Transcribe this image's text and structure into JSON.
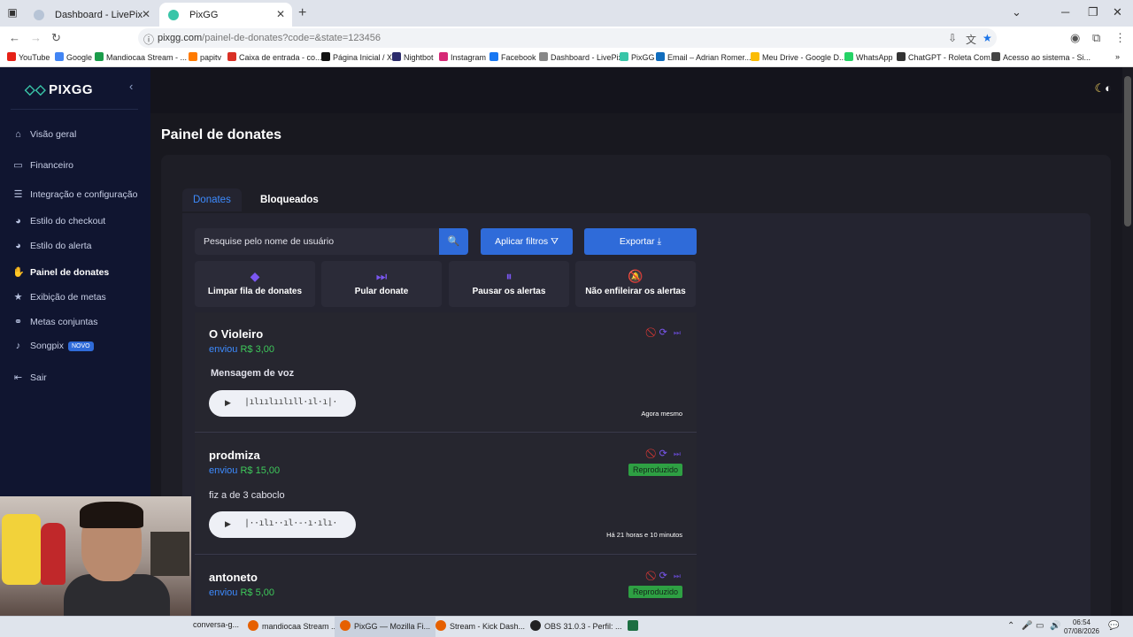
{
  "browser": {
    "tabs": [
      {
        "label": "Dashboard - LivePix",
        "active": false
      },
      {
        "label": "PixGG",
        "active": true
      }
    ],
    "url_host": "pixgg.com",
    "url_path": "/painel-de-donates?code=&state=123456",
    "bookmarks": [
      {
        "label": "YouTube",
        "color": "#e62117"
      },
      {
        "label": "Google",
        "color": "#4285f4"
      },
      {
        "label": "Mandiocaa Stream - ...",
        "color": "#1a9c4a"
      },
      {
        "label": "papitv",
        "color": "#ff7a00"
      },
      {
        "label": "Caixa de entrada - co...",
        "color": "#d93025"
      },
      {
        "label": "Página Inicial / X",
        "color": "#111111"
      },
      {
        "label": "Nightbot",
        "color": "#2b2b6b"
      },
      {
        "label": "Instagram",
        "color": "#d62976"
      },
      {
        "label": "Facebook",
        "color": "#1877f2"
      },
      {
        "label": "Dashboard - LivePix",
        "color": "#888888"
      },
      {
        "label": "PixGG",
        "color": "#39c5a8"
      },
      {
        "label": "Email – Adrian Romer...",
        "color": "#0f6cbd"
      },
      {
        "label": "Meu Drive - Google D...",
        "color": "#fbbc04"
      },
      {
        "label": "WhatsApp",
        "color": "#25d366"
      },
      {
        "label": "ChatGPT - Roleta Com...",
        "color": "#333333"
      },
      {
        "label": "Acesso ao sistema - Si...",
        "color": "#444444"
      }
    ]
  },
  "sidebar": {
    "logo": "PIXGG",
    "items": [
      {
        "label": "Visão geral",
        "icon": "home-icon",
        "glyph": "⌂"
      },
      {
        "label": "Financeiro",
        "icon": "wallet-icon",
        "glyph": "▭"
      },
      {
        "label": "Integração e configuração",
        "icon": "document-icon",
        "glyph": "☰"
      },
      {
        "label": "Estilo do checkout",
        "icon": "palette-icon",
        "glyph": "◕"
      },
      {
        "label": "Estilo do alerta",
        "icon": "palette-icon",
        "glyph": "◕"
      },
      {
        "label": "Painel de donates",
        "icon": "hand-coins-icon",
        "glyph": "✋"
      },
      {
        "label": "Exibição de metas",
        "icon": "star-icon",
        "glyph": "★"
      },
      {
        "label": "Metas conjuntas",
        "icon": "link-icon",
        "glyph": "⚭"
      },
      {
        "label": "Songpix",
        "icon": "music-icon",
        "glyph": "♪",
        "badge": "NOVO"
      },
      {
        "label": "Sair",
        "icon": "logout-icon",
        "glyph": "⇤"
      }
    ],
    "active_index": 5
  },
  "page": {
    "title": "Painel de donates",
    "tabs": [
      "Donates",
      "Bloqueados"
    ],
    "search_placeholder": "Pesquise pelo nome de usuário",
    "filter_label": "Aplicar filtros",
    "export_label": "Exportar",
    "actions": [
      {
        "label": "Limpar fila de donates",
        "icon": "eraser-icon",
        "glyph": "◆"
      },
      {
        "label": "Pular donate",
        "icon": "skip-circle-icon",
        "glyph": "⏭"
      },
      {
        "label": "Pausar os alertas",
        "icon": "pause-circle-icon",
        "glyph": "⏸"
      },
      {
        "label": "Não enfileirar os alertas",
        "icon": "bell-off-icon",
        "glyph": "🔕"
      }
    ]
  },
  "donates": [
    {
      "name": "O Violeiro",
      "sent_prefix": "enviou",
      "amount": "R$ 3,00",
      "message": "Mensagem de voz",
      "time": "Agora mesmo",
      "status": ""
    },
    {
      "name": "prodmiza",
      "sent_prefix": "enviou",
      "amount": "R$ 15,00",
      "message": "fiz a de 3 caboclo",
      "time": "Há 21 horas e 10 minutos",
      "status": "Reproduzido"
    },
    {
      "name": "antoneto",
      "sent_prefix": "enviou",
      "amount": "R$ 5,00",
      "message": "",
      "time": "",
      "status": "Reproduzido"
    }
  ],
  "taskbar": {
    "items": [
      {
        "label": "conversa-g...",
        "color": "#888888"
      },
      {
        "label": "mandiocaa Stream ...",
        "color": "#e66000"
      },
      {
        "label": "PixGG — Mozilla Fi...",
        "color": "#e66000"
      },
      {
        "label": "Stream - Kick Dash...",
        "color": "#e66000"
      },
      {
        "label": "OBS 31.0.3 - Perfil: ...",
        "color": "#222222"
      }
    ],
    "time": "06:54",
    "date": "07/08/2026"
  }
}
